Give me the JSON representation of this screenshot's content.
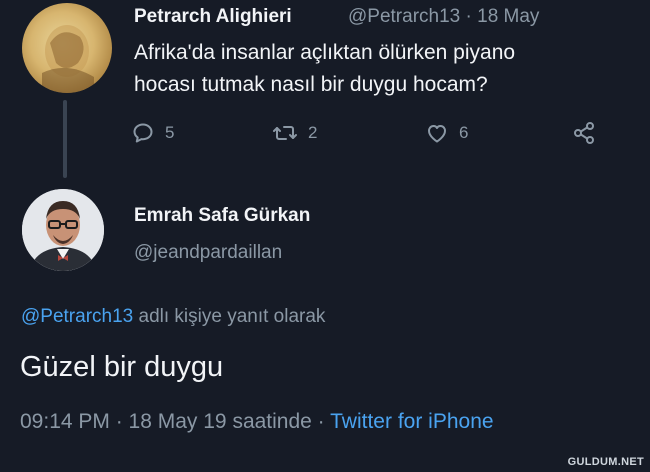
{
  "parent_tweet": {
    "author_name": "Petrarch Alighieri",
    "handle": "@Petrarch13",
    "separator": "·",
    "date": "18 May",
    "text_line1": "Afrika'da insanlar açlıktan ölürken piyano",
    "text_line2": "hocası tutmak nasıl bir duygu hocam?",
    "actions": {
      "reply_count": "5",
      "retweet_count": "2",
      "like_count": "6"
    }
  },
  "main_tweet": {
    "author_name": "Emrah Safa Gürkan",
    "handle": "@jeandpardaillan",
    "replying_mention": "@Petrarch13",
    "replying_suffix": "adlı kişiye yanıt olarak",
    "text": "Güzel bir duygu",
    "timestamp": "09:14 PM · 18 May 19 saatinde ·",
    "source": "Twitter for iPhone"
  },
  "watermark": "GULDUM.NET",
  "colors": {
    "background": "#161b26",
    "text_primary": "#f2f4f7",
    "text_secondary": "#8b98a5",
    "link": "#4aa3f0"
  },
  "icons": [
    "reply-icon",
    "retweet-icon",
    "like-icon",
    "share-icon"
  ]
}
